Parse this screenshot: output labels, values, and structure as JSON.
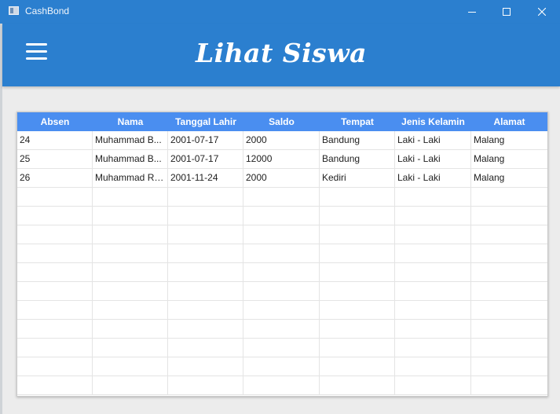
{
  "window": {
    "title": "CashBond",
    "icons": {
      "minimize": "minimize-icon",
      "maximize": "maximize-icon",
      "close": "close-icon",
      "app": "app-icon"
    }
  },
  "header": {
    "title": "Lihat Siswa",
    "menu_icon": "hamburger-menu-icon",
    "background": "#2b7fcf"
  },
  "table": {
    "header_color": "#4a8ef0",
    "columns": [
      "Absen",
      "Nama",
      "Tanggal Lahir",
      "Saldo",
      "Tempat",
      "Jenis Kelamin",
      "Alamat"
    ],
    "rows": [
      [
        "24",
        "Muhammad B...",
        "2001-07-17",
        "2000",
        "Bandung",
        "Laki - Laki",
        "Malang"
      ],
      [
        "25",
        "Muhammad B...",
        "2001-07-17",
        "12000",
        "Bandung",
        "Laki - Laki",
        "Malang"
      ],
      [
        "26",
        "Muhammad Re...",
        "2001-11-24",
        "2000",
        "Kediri",
        "Laki - Laki",
        "Malang"
      ]
    ],
    "empty_rows": 11
  }
}
